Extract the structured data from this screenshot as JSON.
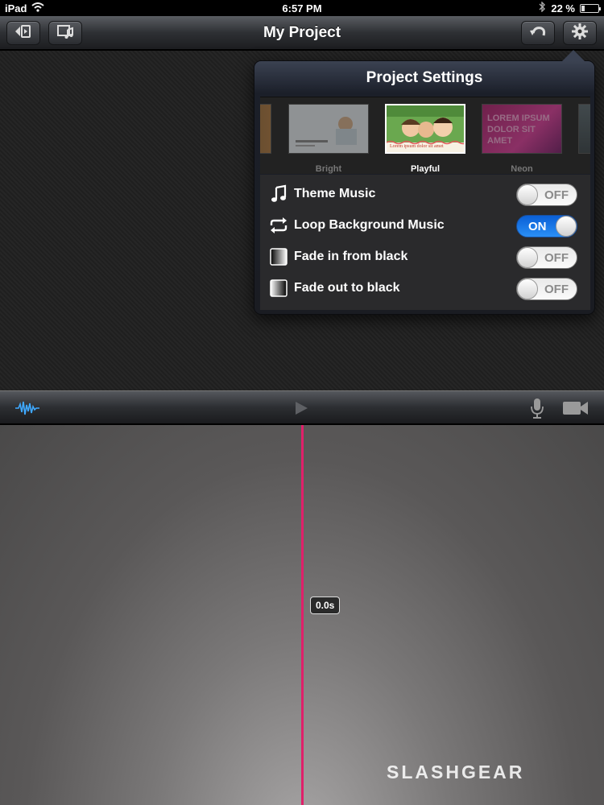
{
  "status_bar": {
    "device": "iPad",
    "time": "6:57 PM",
    "battery": "22 %",
    "battery_level": 0.22
  },
  "toolbar": {
    "title": "My Project"
  },
  "popover": {
    "title": "Project Settings",
    "themes": [
      {
        "label": "Bright",
        "selected": false
      },
      {
        "label": "Playful",
        "selected": true
      },
      {
        "label": "Neon",
        "selected": false,
        "thumb_text": "LOREM IPSUM DOLOR SIT AMET"
      }
    ],
    "playful_caption": "Lorem ipsum dolor sit amet",
    "settings": [
      {
        "label": "Theme Music",
        "icon": "music-note-icon",
        "state": "OFF"
      },
      {
        "label": "Loop Background Music",
        "icon": "loop-icon",
        "state": "ON"
      },
      {
        "label": "Fade in from black",
        "icon": "fade-in-icon",
        "state": "OFF"
      },
      {
        "label": "Fade out to black",
        "icon": "fade-out-icon",
        "state": "OFF"
      }
    ]
  },
  "timeline": {
    "timecode": "0.0s"
  },
  "watermark": "SLASHGEAR",
  "colors": {
    "toggle_on": "#1c7ff0",
    "playhead": "#e0206a",
    "audio_wave": "#3fa9ff"
  }
}
